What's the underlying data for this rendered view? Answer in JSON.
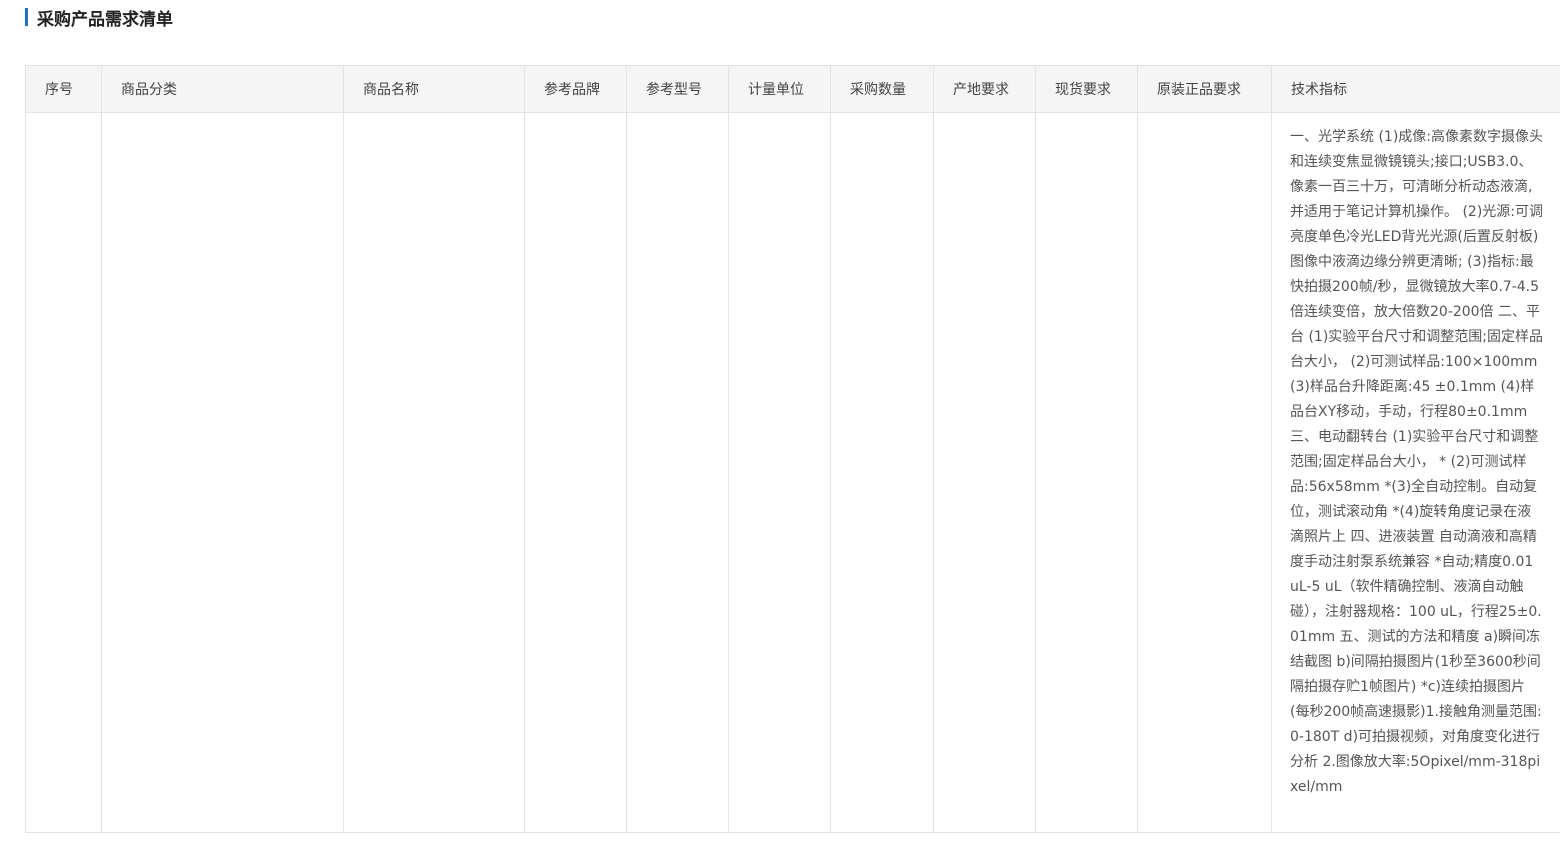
{
  "section": {
    "title": "采购产品需求清单"
  },
  "table": {
    "headers": [
      "序号",
      "商品分类",
      "商品名称",
      "参考品牌",
      "参考型号",
      "计量单位",
      "采购数量",
      "产地要求",
      "现货要求",
      "原装正品要求",
      "技术指标"
    ],
    "rows": [
      {
        "index": "",
        "category": "",
        "name": "",
        "brand": "",
        "model": "",
        "unit": "",
        "quantity": "",
        "origin": "",
        "stock": "",
        "genuine": "",
        "spec": "一、光学系统 (1)成像:高像素数字摄像头和连续变焦显微镜镜头;接口;USB3.0、像素一百三十万，可清晰分析动态液滴,并适用于笔记计算机操作。 (2)光源:可调亮度单色冷光LED背光光源(后置反射板)图像中液滴边缘分辨更清晰; (3)指标:最快拍摄200帧/秒，显微镜放大率0.7-4.5倍连续变倍，放大倍数20-200倍 二、平台 (1)实验平台尺寸和调整范围;固定样品台大小， (2)可测试样品:100×100mm (3)样品台升降距离:45 ±0.1mm (4)样品台XY移动，手动，行程80±0.1mm 三、电动翻转台 (1)实验平台尺寸和调整范围;固定样品台大小， * (2)可测试样品:56x58mm *(3)全自动控制。自动复位，测试滚动角 *(4)旋转角度记录在液滴照片上 四、进液装置 自动滴液和高精度手动注射泵系统兼容 *自动;精度0.01 uL-5 uL（软件精确控制、液滴自动触碰），注射器规格：100 uL，行程25±0.01mm 五、测试的方法和精度 a)瞬间冻结截图 b)间隔拍摄图片(1秒至3600秒间隔拍摄存贮1帧图片) *c)连续拍摄图片(每秒200帧高速摄影)1.接触角测量范围:0-180T d)可拍摄视频，对角度变化进行分析 2.图像放大率:5Opixel/mm-318pixel/mm"
      }
    ]
  },
  "colors": {
    "accent": "#1e6fd9",
    "header_bg": "#f5f5f5",
    "border": "#e4e4e4"
  }
}
